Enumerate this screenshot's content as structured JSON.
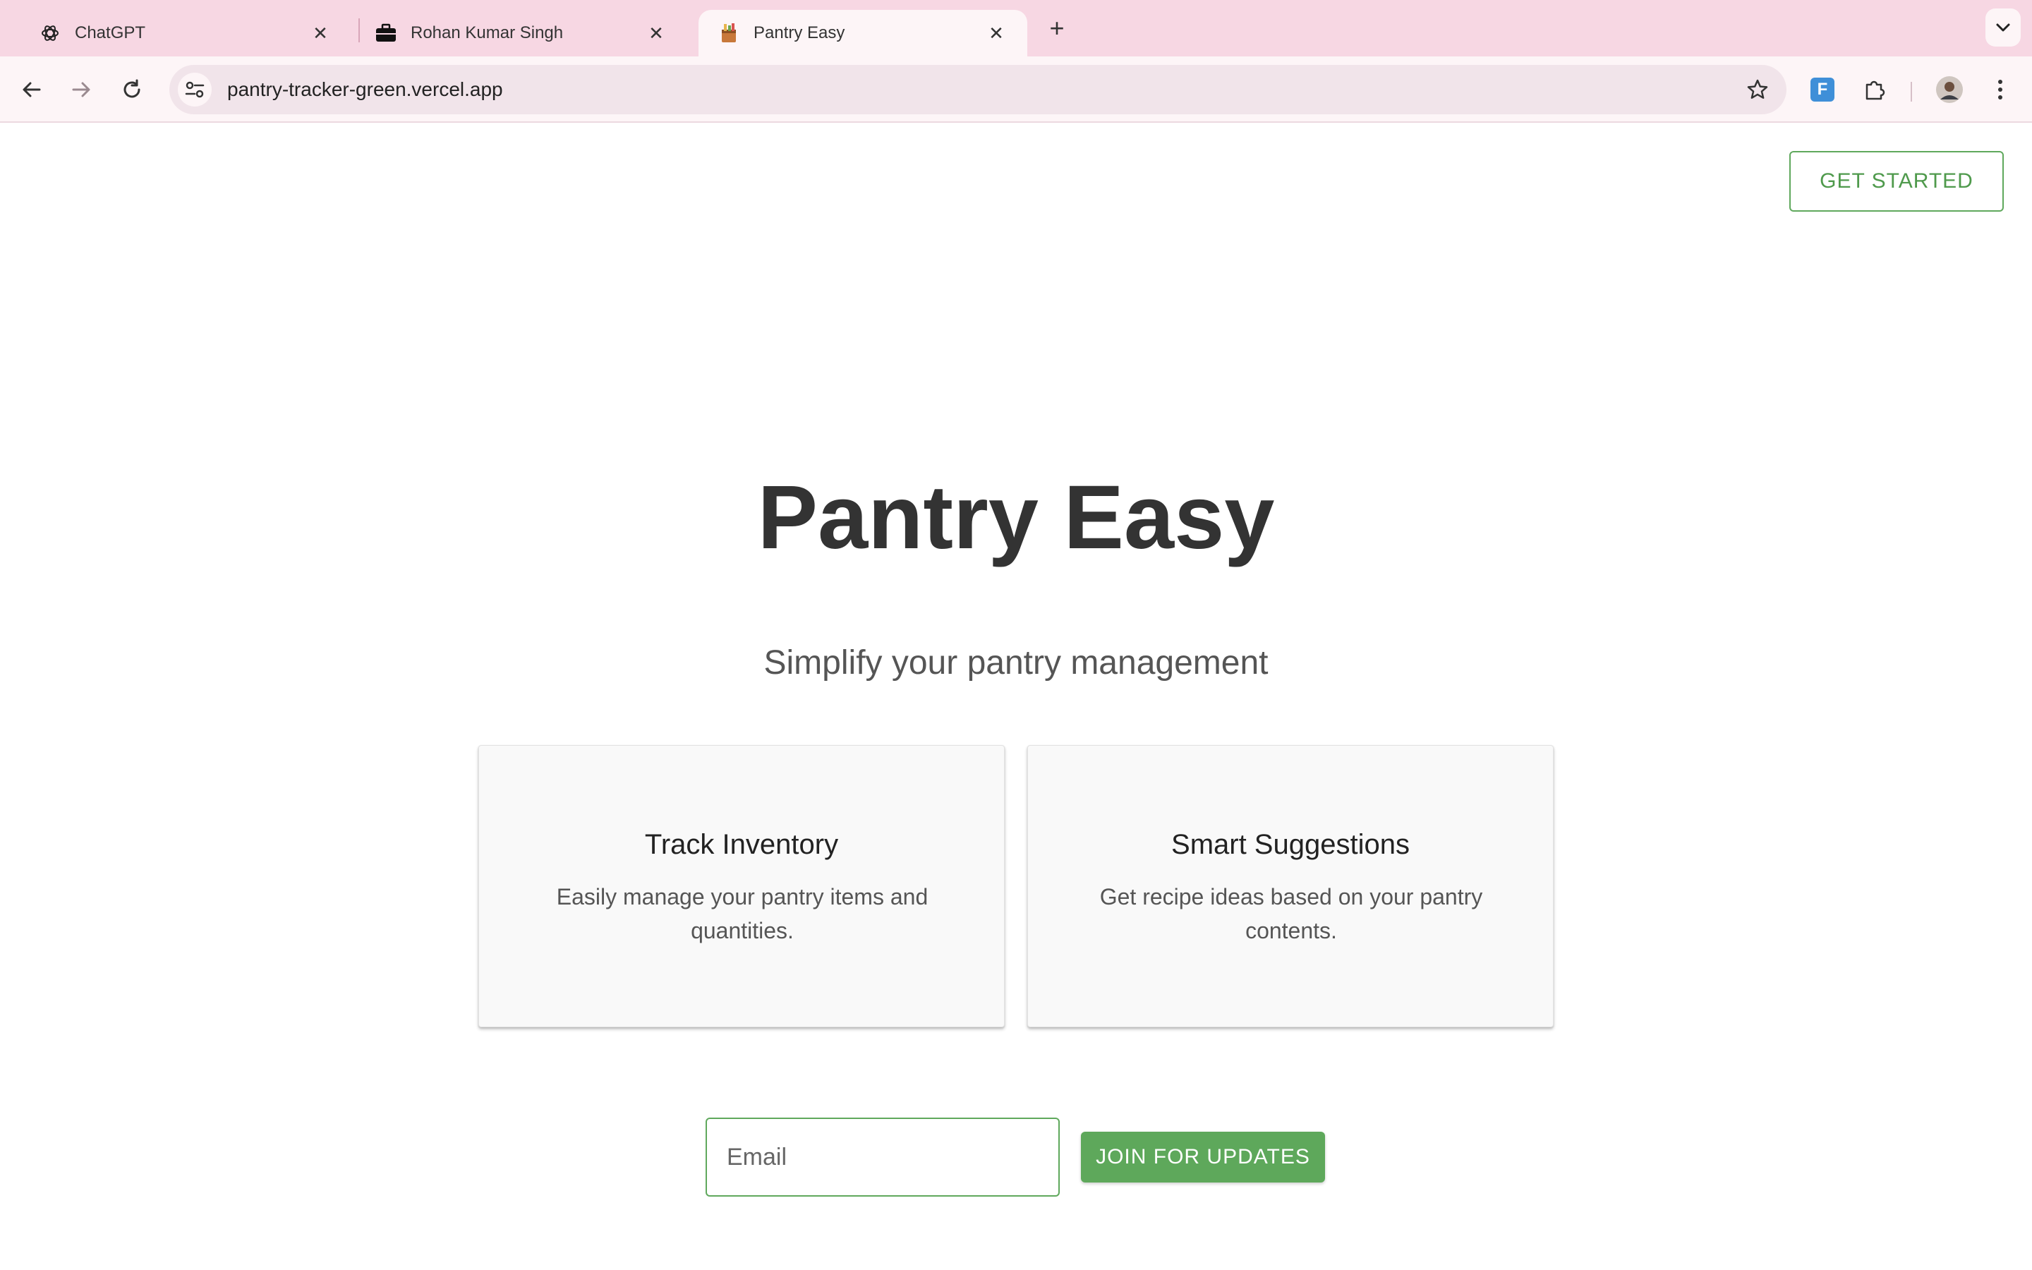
{
  "browser": {
    "tabs": [
      {
        "title": "ChatGPT",
        "icon": "openai-icon",
        "active": false
      },
      {
        "title": "Rohan Kumar Singh",
        "icon": "briefcase-icon",
        "active": false
      },
      {
        "title": "Pantry Easy",
        "icon": "pantry-icon",
        "active": true
      }
    ],
    "new_tab_label": "+",
    "close_glyph": "✕",
    "url": "pantry-tracker-green.vercel.app",
    "extension_label": "F"
  },
  "page": {
    "header": {
      "get_started_label": "GET STARTED"
    },
    "hero": {
      "title": "Pantry Easy",
      "subtitle": "Simplify your pantry management"
    },
    "features": [
      {
        "title": "Track Inventory",
        "description": "Easily manage your pantry items and quantities."
      },
      {
        "title": "Smart Suggestions",
        "description": "Get recipe ideas based on your pantry contents."
      }
    ],
    "signup": {
      "email_placeholder": "Email",
      "email_value": "",
      "join_label": "JOIN FOR UPDATES"
    }
  },
  "colors": {
    "accent_green": "#5ea85b",
    "tab_strip_pink": "#f7d7e3",
    "title_dark": "#333333"
  }
}
